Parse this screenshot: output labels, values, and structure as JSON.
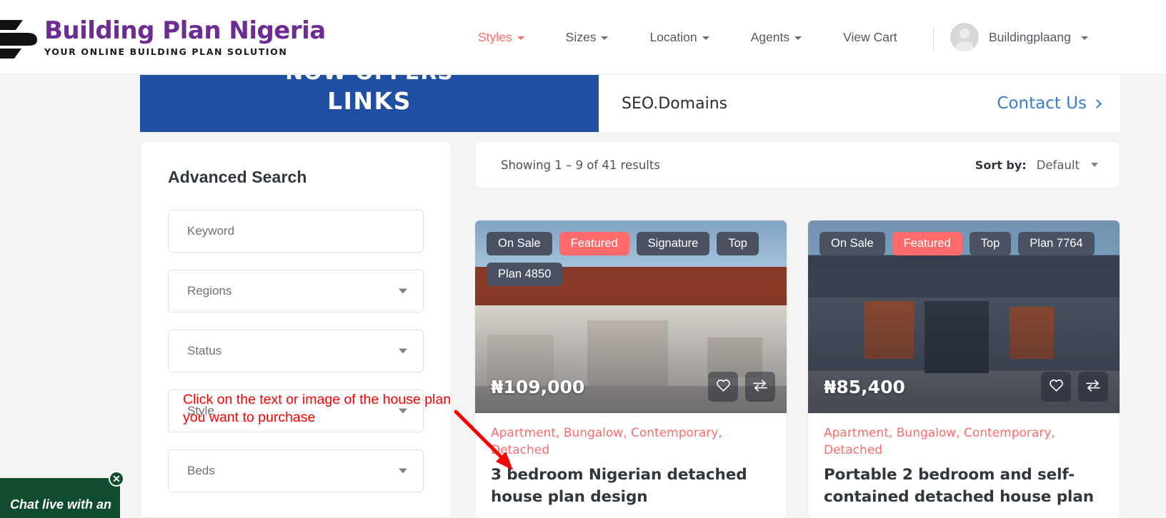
{
  "brand": {
    "logo_title": "Building Plan Nigeria",
    "logo_tagline": "YOUR ONLINE BUILDING PLAN SOLUTION",
    "logo_color": "#6d2c91"
  },
  "nav": {
    "items": [
      {
        "label": "Styles",
        "has_caret": true,
        "active": true
      },
      {
        "label": "Sizes",
        "has_caret": true,
        "active": false
      },
      {
        "label": "Location",
        "has_caret": true,
        "active": false
      },
      {
        "label": "Agents",
        "has_caret": true,
        "active": false
      },
      {
        "label": "View Cart",
        "has_caret": false,
        "active": false
      }
    ],
    "active_color": "#ff6b6b",
    "user": {
      "name": "Buildingplaang",
      "avatar_icon": "user-avatar-icon"
    }
  },
  "banner": {
    "line_top": "NOW OFFERS",
    "line_main": "LINKS",
    "domain": "SEO.Domains",
    "contact_label": "Contact Us",
    "blue": "#1f4fa3",
    "link_color": "#3a7bd5"
  },
  "sidebar": {
    "title": "Advanced Search",
    "fields": [
      {
        "label": "Keyword",
        "type": "text"
      },
      {
        "label": "Regions",
        "type": "select"
      },
      {
        "label": "Status",
        "type": "select"
      },
      {
        "label": "Style",
        "type": "select"
      },
      {
        "label": "Beds",
        "type": "select"
      }
    ]
  },
  "annotation": {
    "line1": "Click on the text or image of the house plan",
    "line2": "you want to purchase",
    "color": "#ff0000"
  },
  "results": {
    "count_text": "Showing 1 – 9 of 41 results",
    "sort_label": "Sort by:",
    "sort_value": "Default"
  },
  "cards": [
    {
      "badges": [
        "On Sale",
        "Featured",
        "Signature",
        "Top",
        "Plan 4850"
      ],
      "featured_index": 1,
      "price": "₦109,000",
      "categories": "Apartment, Bungalow, Contemporary, Detached",
      "title": "3 bedroom Nigerian detached house plan design",
      "favorite_icon": "heart-icon",
      "compare_icon": "compare-arrows-icon"
    },
    {
      "badges": [
        "On Sale",
        "Featured",
        "Top",
        "Plan 7764"
      ],
      "featured_index": 1,
      "price": "₦85,400",
      "categories": "Apartment, Bungalow, Contemporary, Detached",
      "title": "Portable 2 bedroom and self-contained detached house plan",
      "favorite_icon": "heart-icon",
      "compare_icon": "compare-arrows-icon"
    }
  ],
  "chat": {
    "text": "Chat live with an",
    "close_label": "✕",
    "background": "#0f4d2e"
  }
}
